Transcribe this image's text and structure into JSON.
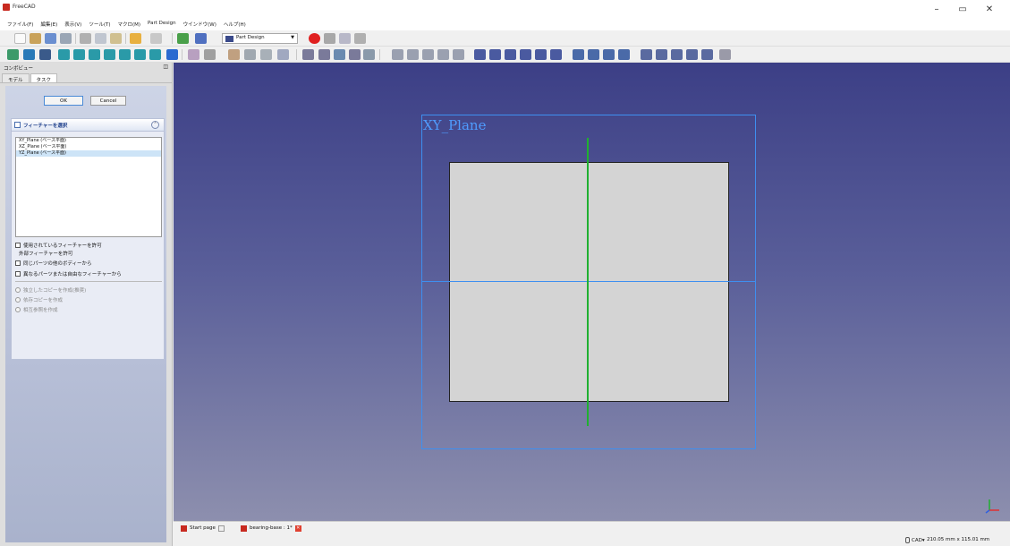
{
  "window": {
    "title": "FreeCAD",
    "minimize": "–",
    "restore": "▭",
    "close": "✕"
  },
  "menu": [
    "ファイル(F)",
    "編集(E)",
    "表示(V)",
    "ツール(T)",
    "マクロ(M)",
    "Part Design",
    "ウインドウ(W)",
    "ヘルプ(H)"
  ],
  "workbench": {
    "selected": "Part Design"
  },
  "combo_view": {
    "title": "コンボビュー",
    "tabs": [
      "モデル",
      "タスク"
    ],
    "ok_label": "OK",
    "cancel_label": "Cancel",
    "feature_panel": {
      "title": "フィーチャーを選択",
      "collapse_glyph": "⌃",
      "items": [
        "XY_Plane (ベース平面)",
        "XZ_Plane (ベース平面)",
        "YZ_Plane (ベース平面)"
      ],
      "selected_index": 2,
      "allow_used": "使用されているフィーチャーを許可",
      "external_label": "外部フィーチャーを許可",
      "other_bodies": "同じパーツの他のボディーから",
      "other_parts": "異なるパーツまたは自由なフィーチャーから",
      "independent_copy": "独立したコピーを作成(推奨)",
      "dependent_copy": "依存コピーを作成",
      "cross_reference": "相互参照を作成"
    }
  },
  "viewport": {
    "plane_label": "XY_Plane",
    "plane_color": "#3e8ff0",
    "axis_color": "#20b030"
  },
  "doc_tabs": [
    {
      "label": "Start page"
    },
    {
      "label": "bearing-base : 1*"
    }
  ],
  "status": {
    "nav_style": "CAD▾",
    "dimensions": "210.05 mm x 115.01 mm"
  }
}
